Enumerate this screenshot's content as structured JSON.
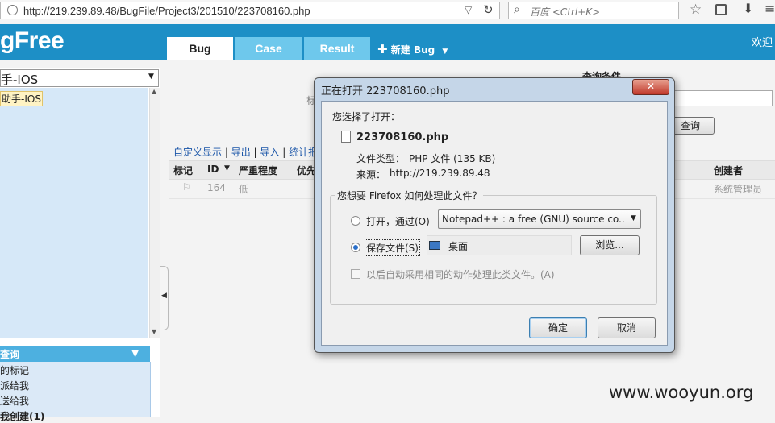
{
  "browser": {
    "url": "http://219.239.89.48/BugFile/Project3/201510/223708160.php",
    "search_placeholder": "百度 <Ctrl+K>"
  },
  "app": {
    "logo": "gFree",
    "tabs": [
      "Bug",
      "Case",
      "Result"
    ],
    "new_bug_label": "新建 Bug",
    "welcome": "欢迎"
  },
  "sidebar": {
    "project_value": "手-IOS",
    "tree_item": "助手-IOS",
    "query_header": "查询",
    "query_items": [
      "的标记",
      "派给我",
      "送给我",
      "我创建(1)"
    ]
  },
  "main": {
    "query_title": "查询条件",
    "query_button": "查询",
    "field_fragment": "标",
    "toolbar_links": [
      "自定义显示",
      "导出",
      "导入",
      "统计报表"
    ],
    "columns": [
      "标记",
      "ID",
      "严重程度",
      "优先",
      "创建者"
    ],
    "row": {
      "id": "164",
      "severity": "低",
      "creator": "系统管理员"
    }
  },
  "dialog": {
    "title": "正在打开 223708160.php",
    "you_chose": "您选择了打开：",
    "filename": "223708160.php",
    "filetype_label": "文件类型：",
    "filetype_value": "PHP 文件 (135 KB)",
    "source_label": "来源：",
    "source_value": "http://219.239.89.48",
    "question": "您想要 Firefox 如何处理此文件？",
    "open_with_label": "打开，通过(O)",
    "open_with_app": "Notepad++ : a free (GNU) source co...",
    "save_label": "保存文件(S)",
    "save_location": "桌面",
    "browse_label": "浏览...",
    "auto_label": "以后自动采用相同的动作处理此类文件。(A)",
    "ok_label": "确定",
    "cancel_label": "取消",
    "selected_option": "save"
  },
  "watermark": "www.wooyun.org",
  "colors": {
    "header": "#1d8fc6",
    "tab_active": "#ffffff",
    "tab_inactive": "#6ec8ec",
    "link": "#1a55a8"
  }
}
